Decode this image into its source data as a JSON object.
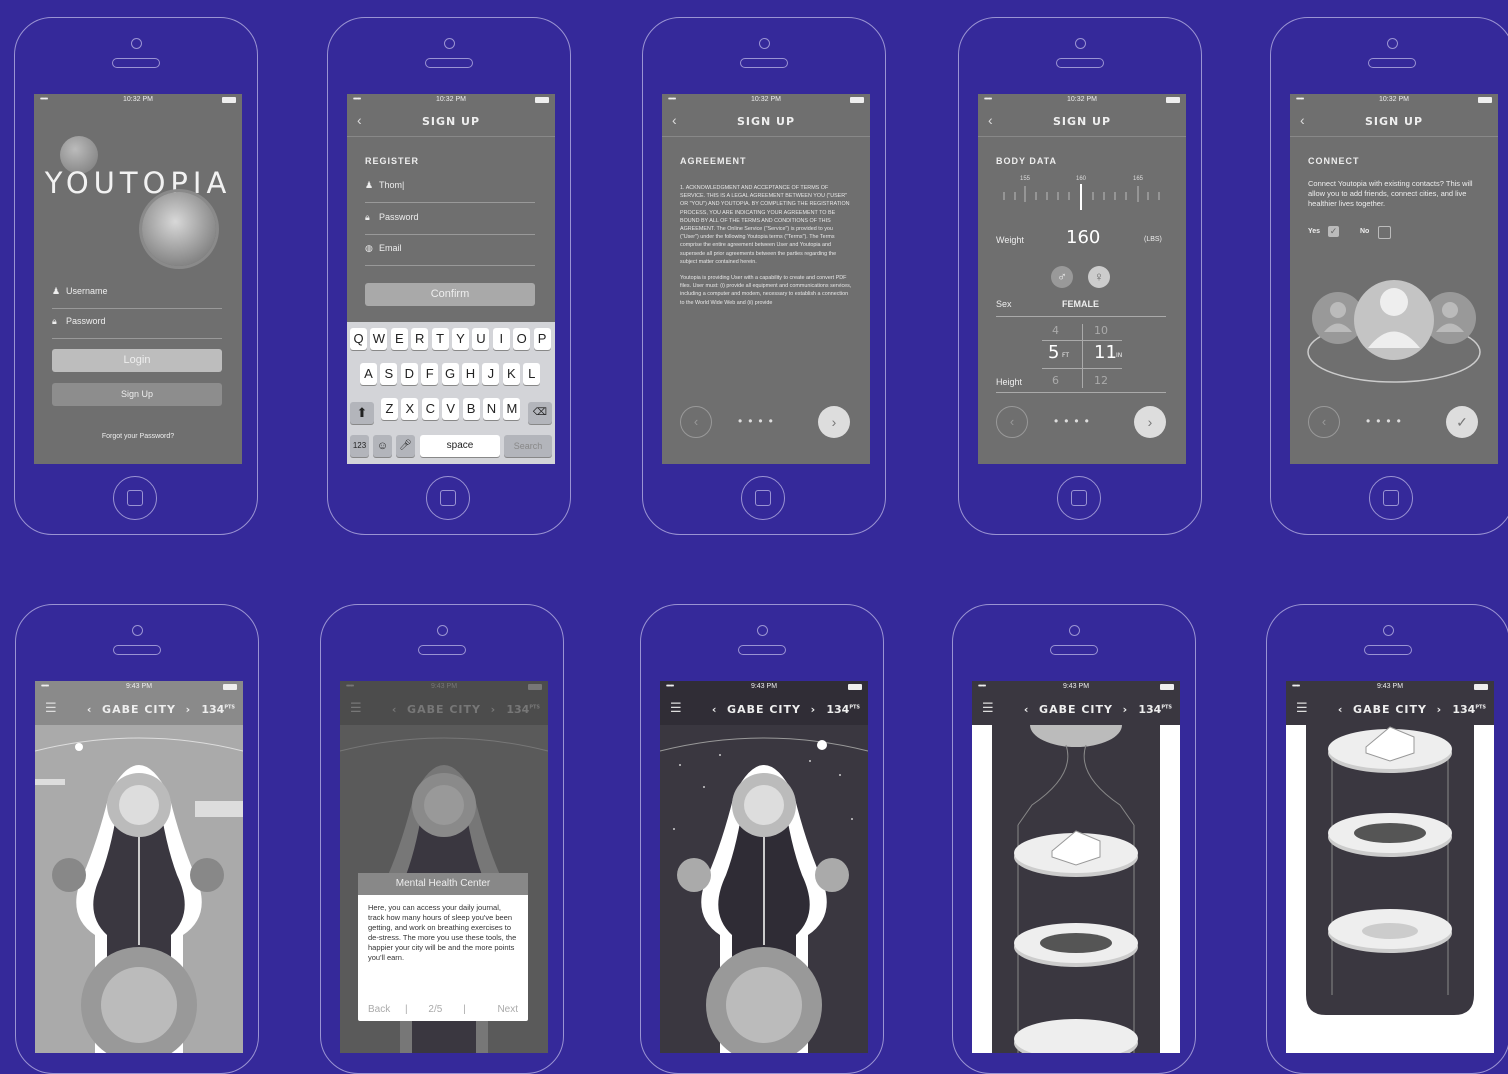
{
  "status": {
    "dots": "•••••",
    "time_signup": "10:32 PM",
    "time_city": "9:43 PM"
  },
  "login": {
    "brand": "YOUTOPIA",
    "username_label": "Username",
    "password_label": "Password",
    "login_button": "Login",
    "signup_button": "Sign Up",
    "forgot_link": "Forgot your Password?"
  },
  "register": {
    "nav_title": "SIGN UP",
    "section": "REGISTER",
    "name_value": "Thom",
    "password_label": "Password",
    "email_label": "Email",
    "confirm_button": "Confirm",
    "keyboard": {
      "row1": [
        "Q",
        "W",
        "E",
        "R",
        "T",
        "Y",
        "U",
        "I",
        "O",
        "P"
      ],
      "row2": [
        "A",
        "S",
        "D",
        "F",
        "G",
        "H",
        "J",
        "K",
        "L"
      ],
      "row3": [
        "Z",
        "X",
        "C",
        "V",
        "B",
        "N",
        "M"
      ],
      "numbers_key": "123",
      "space_key": "space",
      "search_key": "Search"
    }
  },
  "agreement": {
    "nav_title": "SIGN UP",
    "section": "AGREEMENT",
    "para1": "1. ACKNOWLEDGMENT AND ACCEPTANCE OF TERMS OF SERVICE. THIS IS A LEGAL AGREEMENT BETWEEN YOU (\"USER\" OR \"YOU\") AND YOUTOPIA. BY COMPLETING THE REGISTRATION PROCESS, YOU ARE INDICATING YOUR AGREEMENT TO BE BOUND BY ALL OF THE TERMS AND CONDITIONS OF THIS AGREEMENT. The Online Service (\"Service\") is provided to you (\"User\") under the following Youtopia terms (\"Terms\"). The Terms comprise the entire agreement between User and Youtopia and supersede all prior agreements between the parties regarding the subject matter contained herein.",
    "para2": "Youtopia is providing User with a capability to create and convert PDF files. User must: (i) provide all equipment and communications services, including a computer and modem, necessary to establish a connection to the World Wide Web and (ii) provide"
  },
  "body_data": {
    "nav_title": "SIGN UP",
    "section": "BODY DATA",
    "ruler_ticks": [
      "155",
      "160",
      "165"
    ],
    "weight_label": "Weight",
    "weight_value": "160",
    "weight_unit": "(LBS)",
    "sex_label": "Sex",
    "sex_value": "FEMALE",
    "height_label": "Height",
    "ft_above": "4",
    "ft_value": "5",
    "ft_unit": "FT",
    "ft_below": "6",
    "in_above": "10",
    "in_value": "11",
    "in_unit": "IN",
    "in_below": "12"
  },
  "connect": {
    "nav_title": "SIGN UP",
    "section": "CONNECT",
    "text": "Connect Youtopia with existing contacts? This will allow you to add friends, connect cities, and live healthier lives together.",
    "yes_label": "Yes",
    "no_label": "No"
  },
  "city": {
    "name": "GABE CITY",
    "points": "134",
    "points_unit": "PTS"
  },
  "tooltip": {
    "title": "Mental Health Center",
    "body": "Here, you can access your daily journal, track how many hours of sleep you've been getting, and work on breathing exercises to de-stress. The more you use these tools, the happier your city will be and the more points you'll earn.",
    "back": "Back",
    "page": "2/5",
    "next": "Next"
  }
}
